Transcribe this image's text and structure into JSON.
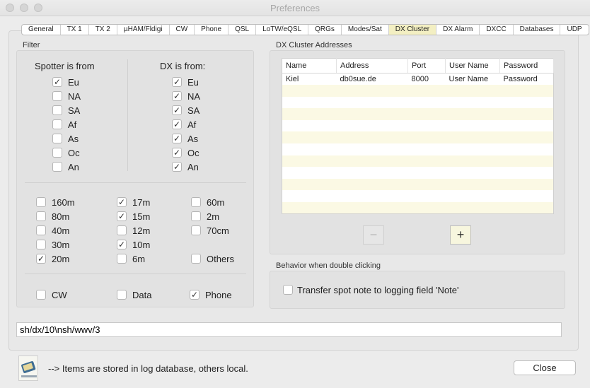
{
  "window": {
    "title": "Preferences"
  },
  "tabs": [
    "General",
    "TX 1",
    "TX 2",
    "µHAM/Fldigi",
    "CW",
    "Phone",
    "QSL",
    "LoTW/eQSL",
    "QRGs",
    "Modes/Sat",
    "DX Cluster",
    "DX Alarm",
    "DXCC",
    "Databases",
    "UDP"
  ],
  "active_tab": "DX Cluster",
  "filter": {
    "label": "Filter",
    "spotter_header": "Spotter is from",
    "dx_header": "DX is from:",
    "spotter": [
      {
        "label": "Eu",
        "checked": true
      },
      {
        "label": "NA",
        "checked": false
      },
      {
        "label": "SA",
        "checked": false
      },
      {
        "label": "Af",
        "checked": false
      },
      {
        "label": "As",
        "checked": false
      },
      {
        "label": "Oc",
        "checked": false
      },
      {
        "label": "An",
        "checked": false
      }
    ],
    "dx": [
      {
        "label": "Eu",
        "checked": true
      },
      {
        "label": "NA",
        "checked": true
      },
      {
        "label": "SA",
        "checked": true
      },
      {
        "label": "Af",
        "checked": true
      },
      {
        "label": "As",
        "checked": true
      },
      {
        "label": "Oc",
        "checked": true
      },
      {
        "label": "An",
        "checked": true
      }
    ],
    "bands": [
      [
        {
          "label": "160m",
          "checked": false
        },
        {
          "label": "80m",
          "checked": false
        },
        {
          "label": "40m",
          "checked": false
        },
        {
          "label": "30m",
          "checked": false
        },
        {
          "label": "20m",
          "checked": true
        }
      ],
      [
        {
          "label": "17m",
          "checked": true
        },
        {
          "label": "15m",
          "checked": true
        },
        {
          "label": "12m",
          "checked": false
        },
        {
          "label": "10m",
          "checked": true
        },
        {
          "label": "6m",
          "checked": false
        }
      ],
      [
        {
          "label": "60m",
          "checked": false
        },
        {
          "label": "2m",
          "checked": false
        },
        {
          "label": "70cm",
          "checked": false
        },
        {
          "label": "Others",
          "checked": false
        }
      ]
    ],
    "modes": [
      {
        "label": "CW",
        "checked": false
      },
      {
        "label": "Data",
        "checked": false
      },
      {
        "label": "Phone",
        "checked": true
      }
    ]
  },
  "cluster": {
    "label": "DX Cluster Addresses",
    "columns": [
      "Name",
      "Address",
      "Port",
      "User Name",
      "Password"
    ],
    "rows": [
      {
        "name": "Kiel",
        "address": "db0sue.de",
        "port": "8000",
        "user_placeholder": "User Name",
        "password_placeholder": "Password"
      }
    ],
    "remove_label": "−",
    "add_label": "+"
  },
  "behavior": {
    "label": "Behavior when double clicking",
    "transfer_label": "Transfer spot note to logging field 'Note'",
    "transfer_checked": false
  },
  "command": {
    "value": "sh/dx/10\\nsh/wwv/3"
  },
  "footer": {
    "note": "--> Items are stored in log database, others local.",
    "close_label": "Close"
  },
  "icons": {
    "checkmark": "✓",
    "logo": "logbook-icon"
  }
}
